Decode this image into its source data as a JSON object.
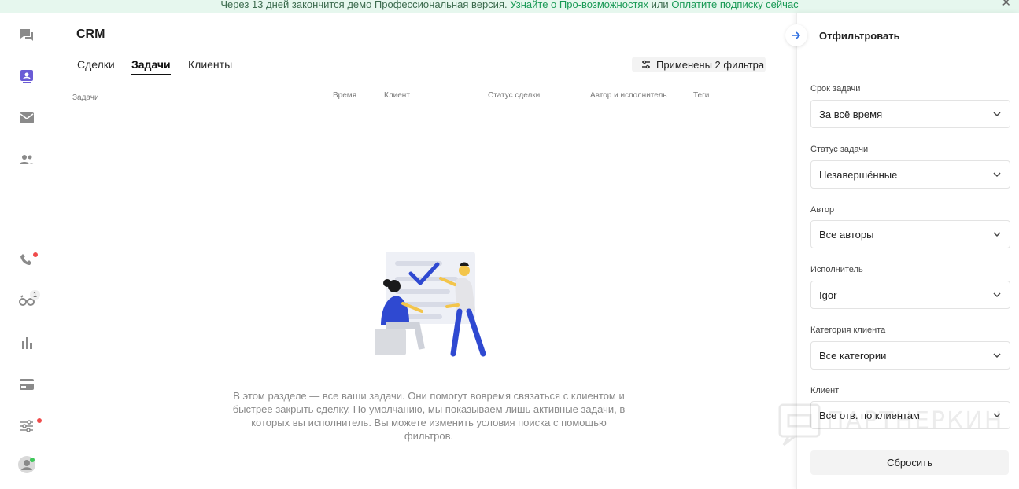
{
  "banner": {
    "text": "Через 13 дней закончится демо Профессиональная версия.",
    "link1": "Узнайте о Про-возможностях",
    "connector": "или",
    "link2": "Оплатите подписку сейчас",
    "close": "✕"
  },
  "sidebar": {
    "items": [
      {
        "icon": "chat-icon"
      },
      {
        "icon": "crm-icon",
        "active": true
      },
      {
        "icon": "mail-icon"
      },
      {
        "icon": "contacts-icon"
      },
      {
        "icon": "phone-icon",
        "dot": "#f04b4b"
      },
      {
        "icon": "glasses-icon",
        "badge": "1"
      },
      {
        "icon": "stats-icon"
      },
      {
        "icon": "billing-icon"
      },
      {
        "icon": "settings-icon",
        "dot": "#f04b4b"
      },
      {
        "icon": "avatar-icon",
        "dot": "#3fc75a"
      }
    ],
    "accent": "#6a5bd6"
  },
  "page": {
    "title": "CRM",
    "tabs": [
      "Сделки",
      "Задачи",
      "Клиенты"
    ],
    "active_tab": "Задачи",
    "filter_button": "Применены 2 фильтра",
    "columns": [
      "Задачи",
      "Время",
      "Клиент",
      "Статус сделки",
      "Автор и исполнитель",
      "Теги"
    ],
    "empty_text": "В этом разделе — все ваши задачи. Они помогут вовремя связаться с клиентом и быстрее закрыть сделку. По умолчанию, мы показываем лишь активные задачи, в которых вы исполнитель. Вы можете изменить условия поиска с помощью фильтров."
  },
  "filters": {
    "title": "Отфильтровать",
    "fields": [
      {
        "label": "Срок задачи",
        "value": "За всё время"
      },
      {
        "label": "Статус задачи",
        "value": "Незавершённые"
      },
      {
        "label": "Автор",
        "value": "Все авторы"
      },
      {
        "label": "Исполнитель",
        "value": "Igor"
      },
      {
        "label": "Категория клиента",
        "value": "Все категории"
      },
      {
        "label": "Клиент",
        "value": "Все отв. по клиентам"
      }
    ],
    "reset": "Сбросить",
    "accent": "#2f6fe0"
  },
  "watermark": "ПАРТНЕРКИН"
}
